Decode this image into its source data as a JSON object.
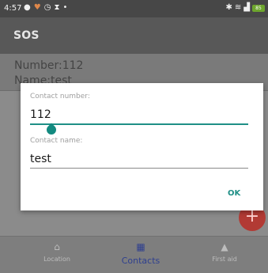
{
  "status_bar": {
    "time": "4:57",
    "left_icons": [
      "app-icon",
      "heart-icon",
      "timer-icon",
      "hourglass-icon",
      "dot-icon"
    ],
    "right_icons": [
      "bluetooth-icon",
      "wifi-icon",
      "signal-icon",
      "battery-icon"
    ],
    "battery_text": "85"
  },
  "appbar": {
    "title": "SOS"
  },
  "contact": {
    "number_line": "Number:112",
    "name_line": "Name:test"
  },
  "dialog": {
    "number_label": "Contact number:",
    "number_value": "112",
    "name_label": "Contact name:",
    "name_value": "test",
    "ok_label": "OK"
  },
  "bottom_nav": {
    "items": [
      {
        "label": "Location",
        "icon": "home-icon"
      },
      {
        "label": "Contacts",
        "icon": "grid-icon"
      },
      {
        "label": "First aid",
        "icon": "bell-icon"
      }
    ]
  },
  "colors": {
    "accent": "#1f8f86",
    "fab": "#b23a34",
    "nav_active": "#2e3f8f"
  }
}
